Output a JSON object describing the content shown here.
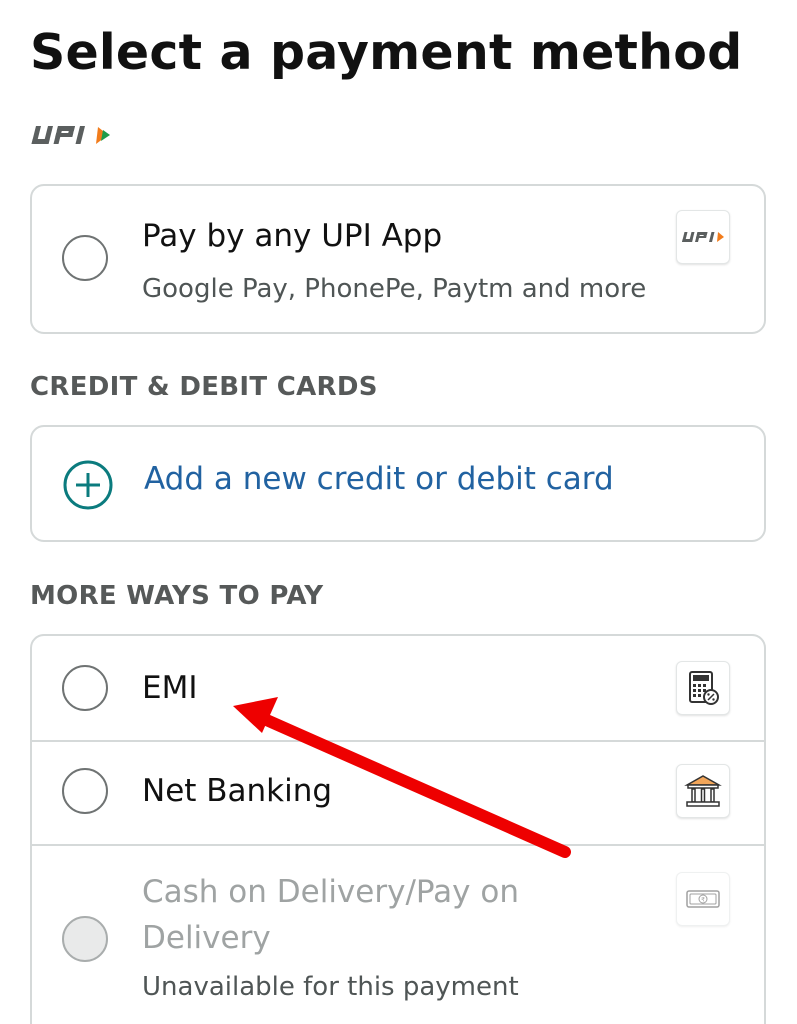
{
  "page_title": "Select a payment method",
  "upi_logo_text": "UPI",
  "upi_option": {
    "label": "Pay by any UPI App",
    "sublabel": "Google Pay, PhonePe, Paytm and more",
    "icon": "upi-logo-icon"
  },
  "cards_section": {
    "heading": "CREDIT & DEBIT CARDS",
    "add_card_label": "Add a new credit or debit card",
    "add_icon": "plus-circle-icon"
  },
  "more_ways_section": {
    "heading": "MORE WAYS TO PAY",
    "options": [
      {
        "label": "EMI",
        "icon": "calculator-percent-icon",
        "enabled": true
      },
      {
        "label": "Net Banking",
        "icon": "bank-icon",
        "enabled": true
      },
      {
        "label_line1": "Cash on Delivery/Pay on",
        "label_line2": "Delivery",
        "sublabel": "Unavailable for this payment",
        "icon": "cash-note-icon",
        "enabled": false
      }
    ]
  },
  "annotation": {
    "arrow_color": "#ee0000",
    "points_to": "EMI"
  },
  "colors": {
    "link_blue": "#2162a1",
    "teal_icon": "#0b7b7e",
    "border_grey": "#d5d9d9",
    "disabled_text": "#9fa3a3"
  }
}
